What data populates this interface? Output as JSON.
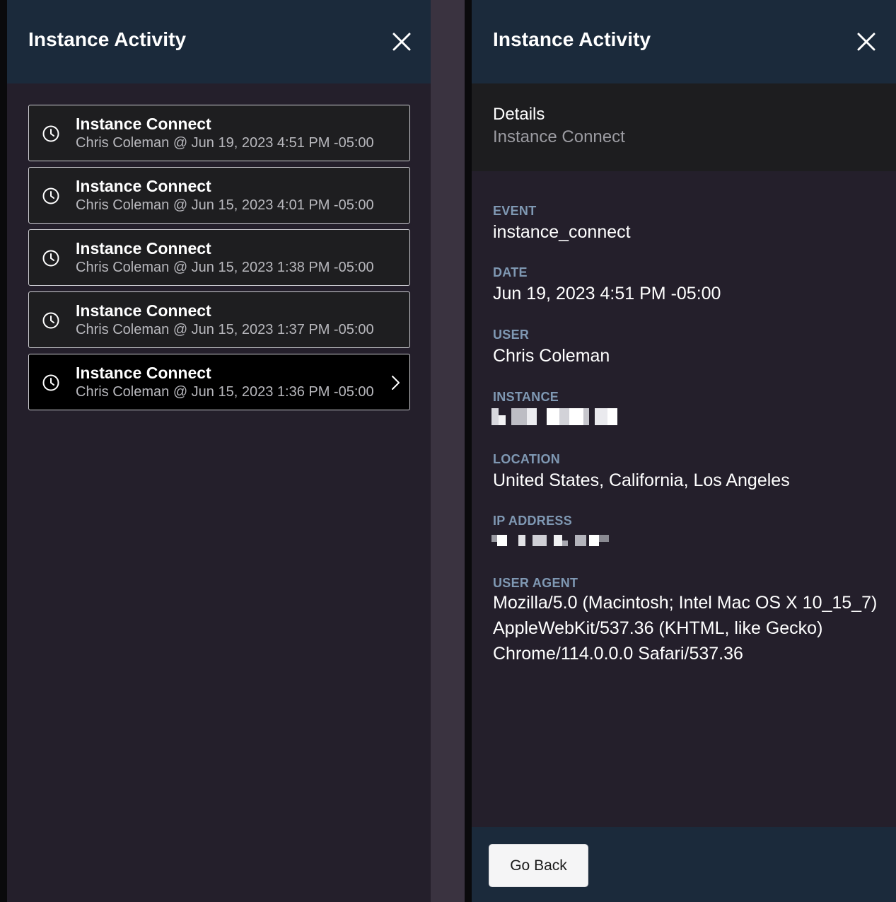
{
  "left_panel": {
    "title": "Instance Activity",
    "items": [
      {
        "title": "Instance Connect",
        "subtitle": "Chris Coleman @ Jun 19, 2023 4:51 PM -05:00"
      },
      {
        "title": "Instance Connect",
        "subtitle": "Chris Coleman @ Jun 15, 2023 4:01 PM -05:00"
      },
      {
        "title": "Instance Connect",
        "subtitle": "Chris Coleman @ Jun 15, 2023 1:38 PM -05:00"
      },
      {
        "title": "Instance Connect",
        "subtitle": "Chris Coleman @ Jun 15, 2023 1:37 PM -05:00"
      },
      {
        "title": "Instance Connect",
        "subtitle": "Chris Coleman @ Jun 15, 2023 1:36 PM -05:00"
      }
    ]
  },
  "right_panel": {
    "title": "Instance Activity",
    "details": {
      "label": "Details",
      "subtitle": "Instance Connect"
    },
    "fields": {
      "event": {
        "label": "EVENT",
        "value": "instance_connect"
      },
      "date": {
        "label": "DATE",
        "value": "Jun 19, 2023 4:51 PM -05:00"
      },
      "user": {
        "label": "USER",
        "value": "Chris Coleman"
      },
      "instance": {
        "label": "INSTANCE"
      },
      "location": {
        "label": "LOCATION",
        "value": "United States, California, Los Angeles"
      },
      "ip_address": {
        "label": "IP ADDRESS"
      },
      "user_agent": {
        "label": "USER AGENT",
        "lines": [
          "Mozilla/5.0 (Macintosh; Intel Mac OS X 10_15_7)",
          "AppleWebKit/537.36 (KHTML, like Gecko)",
          "Chrome/114.0.0.0 Safari/537.36"
        ]
      }
    },
    "footer": {
      "go_back_label": "Go Back"
    }
  },
  "colors": {
    "header_bg": "#1b2a3b",
    "panel_bg": "#241f2b",
    "field_label": "#7f98b3",
    "item_border": "#cfcfd4"
  },
  "icons": {
    "close": "close-icon",
    "clock": "clock-icon",
    "chevron": "chevron-right-icon"
  }
}
